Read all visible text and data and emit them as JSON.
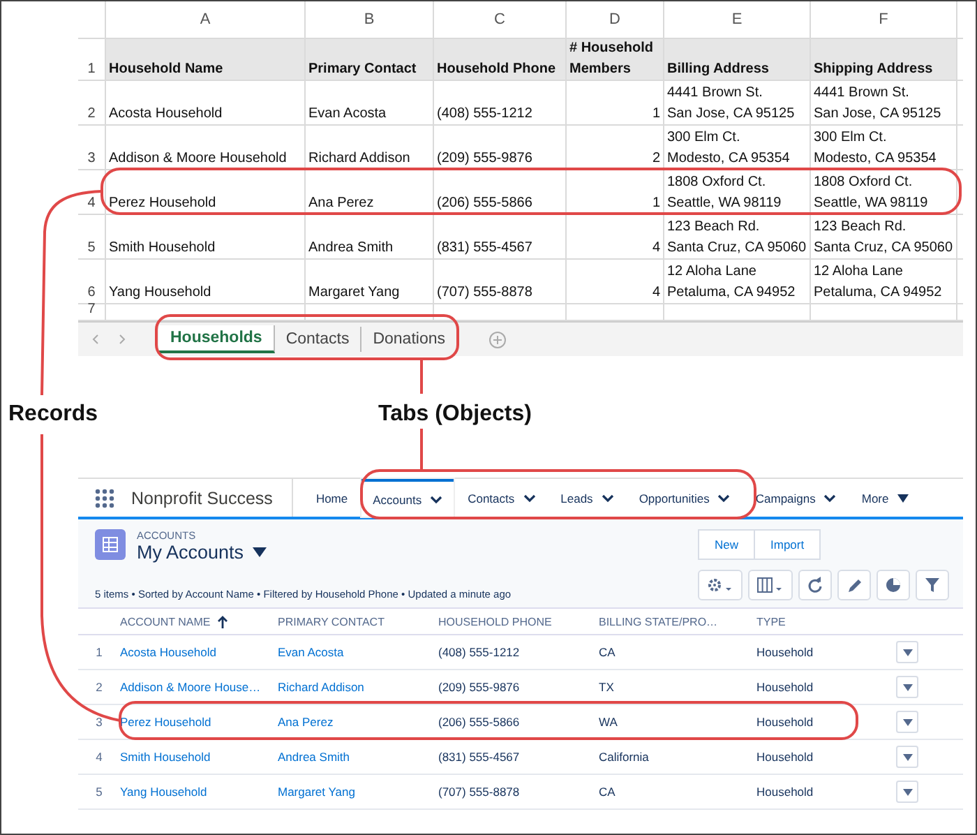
{
  "spreadsheet": {
    "column_letters": [
      "A",
      "B",
      "C",
      "D",
      "E",
      "F"
    ],
    "header": {
      "row_number": "1",
      "cells": [
        "Household Name",
        "Primary Contact",
        "Household Phone",
        "# Household Members",
        "Billing Address",
        "Shipping Address"
      ]
    },
    "rows": [
      {
        "row_number": "2",
        "household_name": "Acosta Household",
        "primary_contact": "Evan Acosta",
        "household_phone": "(408) 555-1212",
        "household_members": "1",
        "billing_address": "4441 Brown St.\nSan Jose, CA 95125",
        "shipping_address": "4441 Brown St.\nSan Jose, CA 95125"
      },
      {
        "row_number": "3",
        "household_name": "Addison & Moore Household",
        "primary_contact": "Richard Addison",
        "household_phone": "(209) 555-9876",
        "household_members": "2",
        "billing_address": "300 Elm Ct.\nModesto, CA 95354",
        "shipping_address": "300 Elm Ct.\nModesto, CA 95354"
      },
      {
        "row_number": "4",
        "household_name": "Perez Household",
        "primary_contact": "Ana Perez",
        "household_phone": "(206) 555-5866",
        "household_members": "1",
        "billing_address": "1808 Oxford Ct.\nSeattle, WA 98119",
        "shipping_address": "1808 Oxford Ct.\nSeattle, WA 98119"
      },
      {
        "row_number": "5",
        "household_name": "Smith Household",
        "primary_contact": "Andrea Smith",
        "household_phone": "(831) 555-4567",
        "household_members": "4",
        "billing_address": "123 Beach Rd.\nSanta Cruz, CA 95060",
        "shipping_address": "123 Beach Rd.\nSanta Cruz, CA 95060"
      },
      {
        "row_number": "6",
        "household_name": "Yang Household",
        "primary_contact": "Margaret Yang",
        "household_phone": "(707) 555-8878",
        "household_members": "4",
        "billing_address": "12 Aloha Lane\nPetaluma, CA 94952",
        "shipping_address": "12 Aloha Lane\nPetaluma, CA 94952"
      }
    ],
    "empty_rows": [
      "7"
    ],
    "sheet_tabs": [
      {
        "label": "Households",
        "selected": true
      },
      {
        "label": "Contacts",
        "selected": false
      },
      {
        "label": "Donations",
        "selected": false
      }
    ]
  },
  "annotations": {
    "labels": [
      {
        "text": "Records"
      },
      {
        "text": "Tabs (Objects)"
      }
    ]
  },
  "salesforce": {
    "app_name": "Nonprofit Success",
    "nav_tabs": [
      {
        "label": "Home",
        "selected": false,
        "kind": "plain"
      },
      {
        "label": "Accounts",
        "selected": true,
        "kind": "menu"
      },
      {
        "label": "Contacts",
        "selected": false,
        "kind": "menu"
      },
      {
        "label": "Leads",
        "selected": false,
        "kind": "menu"
      },
      {
        "label": "Opportunities",
        "selected": false,
        "kind": "menu"
      },
      {
        "label": "Campaigns",
        "selected": false,
        "kind": "menu"
      },
      {
        "label": "More",
        "selected": false,
        "kind": "overflow"
      }
    ],
    "object_label": "ACCOUNTS",
    "list_view": "My Accounts",
    "actions": [
      "New",
      "Import"
    ],
    "status": "5 items • Sorted by Account Name • Filtered by Household Phone • Updated a minute ago",
    "columns": [
      {
        "label": "ACCOUNT NAME",
        "sorted": true
      },
      {
        "label": "PRIMARY CONTACT",
        "sorted": false
      },
      {
        "label": "HOUSEHOLD PHONE",
        "sorted": false
      },
      {
        "label": "BILLING STATE/PRO…",
        "sorted": false
      },
      {
        "label": "TYPE",
        "sorted": false
      }
    ],
    "rows": [
      {
        "number": "1",
        "account_name": "Acosta Household",
        "primary_contact": "Evan Acosta",
        "household_phone": "(408) 555-1212",
        "billing_state": "CA",
        "type": "Household"
      },
      {
        "number": "2",
        "account_name": "Addison & Moore House…",
        "primary_contact": "Richard Addison",
        "household_phone": "(209) 555-9876",
        "billing_state": "TX",
        "type": "Household"
      },
      {
        "number": "3",
        "account_name": "Perez Household",
        "primary_contact": "Ana Perez",
        "household_phone": "(206) 555-5866",
        "billing_state": "WA",
        "type": "Household"
      },
      {
        "number": "4",
        "account_name": "Smith Household",
        "primary_contact": "Andrea Smith",
        "household_phone": "(831) 555-4567",
        "billing_state": "California",
        "type": "Household"
      },
      {
        "number": "5",
        "account_name": "Yang Household",
        "primary_contact": "Margaret Yang",
        "household_phone": "(707) 555-8878",
        "billing_state": "CA",
        "type": "Household"
      }
    ]
  }
}
